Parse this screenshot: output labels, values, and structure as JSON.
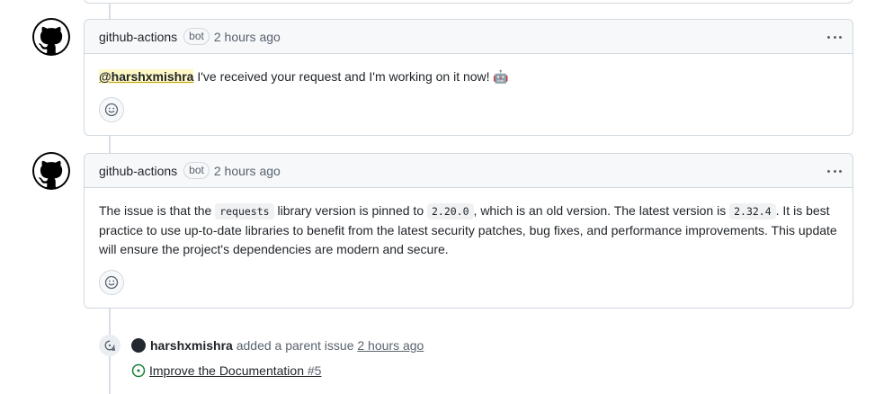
{
  "comments": [
    {
      "author": "github-actions",
      "badge": "bot",
      "time": "2 hours ago",
      "mention": "@harshxmishra",
      "body_text": " I've received your request and I'm working on it now! 🤖"
    },
    {
      "author": "github-actions",
      "badge": "bot",
      "time": "2 hours ago",
      "body_parts": {
        "p1": "The issue is that the ",
        "code1": "requests",
        "p2": " library version is pinned to ",
        "code2": "2.20.0",
        "p3": ", which is an old version. The latest version is ",
        "code3": "2.32.4",
        "p4": ". It is best practice to use up-to-date libraries to benefit from the latest security patches, bug fixes, and performance improvements. This update will ensure the project's dependencies are modern and secure."
      }
    }
  ],
  "event": {
    "actor": "harshxmishra",
    "action": " added a parent issue ",
    "time": "2 hours ago",
    "issue_title": "Improve the Documentation",
    "issue_number": "#5"
  },
  "colors": {
    "accent_green": "#1a7f37",
    "mention_bg": "#fff8c5",
    "border": "#d1d9e0"
  },
  "icons": [
    "github-logo-icon",
    "kebab-menu-icon",
    "smiley-icon",
    "parent-issue-icon",
    "issue-open-icon"
  ]
}
